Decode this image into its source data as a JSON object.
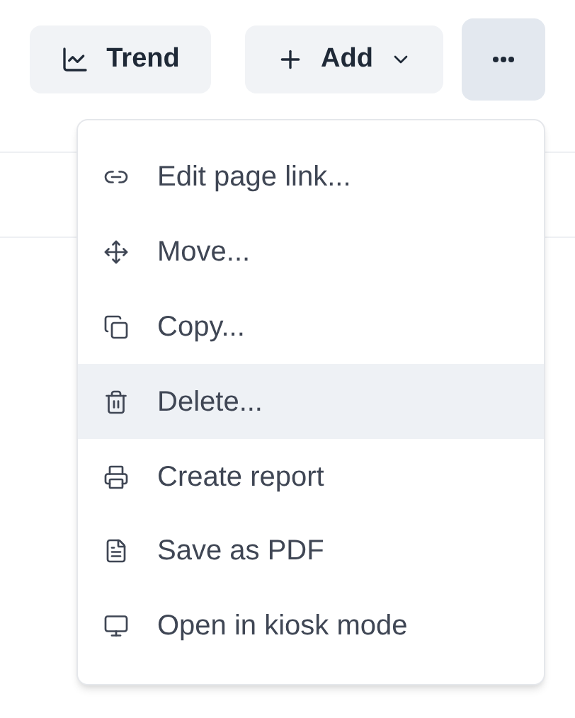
{
  "toolbar": {
    "trend_button": {
      "label": "Trend"
    },
    "add_button": {
      "label": "Add"
    },
    "more_button": {
      "pressed": true
    }
  },
  "menu": {
    "items": [
      {
        "label": "Edit page link...",
        "selected": false
      },
      {
        "label": "Move...",
        "selected": false
      },
      {
        "label": "Copy...",
        "selected": false
      },
      {
        "label": "Delete...",
        "selected": true
      },
      {
        "label": "Create report",
        "selected": false
      },
      {
        "label": "Save as PDF",
        "selected": false
      },
      {
        "label": "Open in kiosk mode",
        "selected": false
      }
    ]
  }
}
